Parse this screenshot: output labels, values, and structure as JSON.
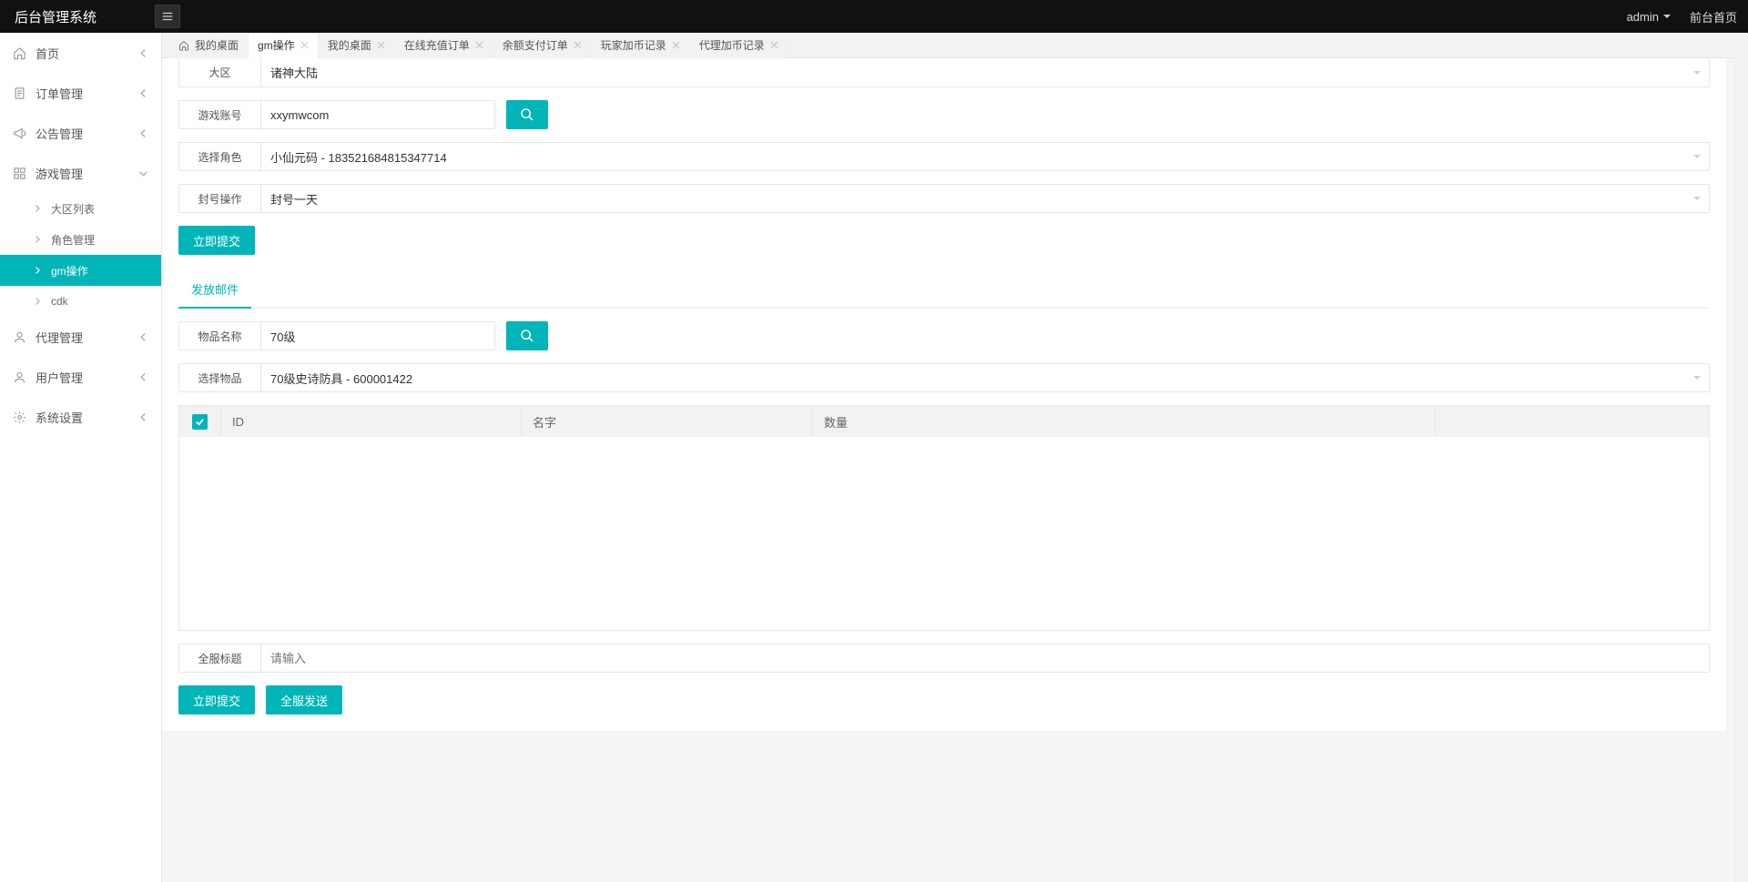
{
  "header": {
    "title": "后台管理系统",
    "user": "admin",
    "front_link": "前台首页"
  },
  "sidebar": {
    "items": [
      {
        "label": "首页"
      },
      {
        "label": "订单管理"
      },
      {
        "label": "公告管理"
      },
      {
        "label": "游戏管理"
      },
      {
        "label": "代理管理"
      },
      {
        "label": "用户管理"
      },
      {
        "label": "系统设置"
      }
    ],
    "game_sub": [
      {
        "label": "大区列表"
      },
      {
        "label": "角色管理"
      },
      {
        "label": "gm操作"
      },
      {
        "label": "cdk"
      }
    ]
  },
  "tabs": [
    {
      "label": "我的桌面",
      "home": true
    },
    {
      "label": "gm操作",
      "active": true
    },
    {
      "label": "我的桌面"
    },
    {
      "label": "在线充值订单"
    },
    {
      "label": "余额支付订单"
    },
    {
      "label": "玩家加币记录"
    },
    {
      "label": "代理加币记录"
    }
  ],
  "form": {
    "region_label": "大区",
    "region_value": "诸神大陆",
    "account_label": "游戏账号",
    "account_value": "xxymwcom",
    "role_label": "选择角色",
    "role_value": "小仙元码 - 183521684815347714",
    "ban_label": "封号操作",
    "ban_value": "封号一天",
    "submit1": "立即提交",
    "mail_tab": "发放邮件",
    "item_name_label": "物品名称",
    "item_name_value": "70级",
    "item_select_label": "选择物品",
    "item_select_value": "70级史诗防具 - 600001422",
    "th_id": "ID",
    "th_name": "名字",
    "th_qty": "数量",
    "global_title_label": "全服标题",
    "global_title_placeholder": "请输入",
    "submit2": "立即提交",
    "global_send": "全服发送"
  }
}
